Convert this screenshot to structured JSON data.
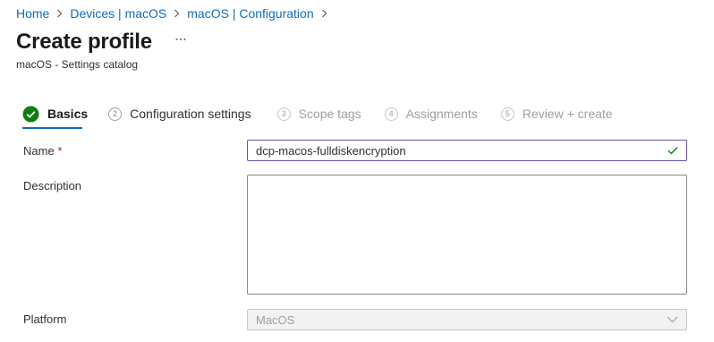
{
  "breadcrumb": {
    "items": [
      "Home",
      "Devices | macOS",
      "macOS | Configuration"
    ]
  },
  "header": {
    "title": "Create profile",
    "more_label": "...",
    "subtitle": "macOS - Settings catalog"
  },
  "steps": [
    {
      "number": "",
      "label": "Basics",
      "state": "completed"
    },
    {
      "number": "2",
      "label": "Configuration settings",
      "state": "upcoming"
    },
    {
      "number": "3",
      "label": "Scope tags",
      "state": "disabled"
    },
    {
      "number": "4",
      "label": "Assignments",
      "state": "disabled"
    },
    {
      "number": "5",
      "label": "Review + create",
      "state": "disabled"
    }
  ],
  "form": {
    "name_label": "Name",
    "required_marker": "*",
    "name_value": "dcp-macos-fulldiskencryption",
    "description_label": "Description",
    "description_value": "",
    "platform_label": "Platform",
    "platform_value": "MacOS"
  },
  "colors": {
    "link": "#0f6cbd",
    "success": "#107c10",
    "input_focus_border": "#6e4eae",
    "required": "#a4262c"
  }
}
